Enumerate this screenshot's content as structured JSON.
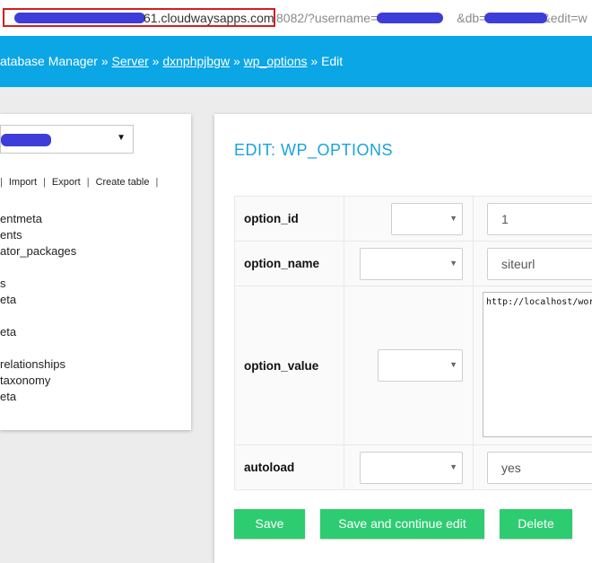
{
  "url": {
    "host": "61.cloudwaysapps.com",
    "rest": "8082/?username=",
    "rest2": "&db=",
    "rest3": "&edit=w"
  },
  "header": {
    "prefix": "atabase Manager » ",
    "crumbs": [
      "Server",
      "dxnphpjbgw",
      "wp_options"
    ],
    "separator": " » ",
    "current": "Edit"
  },
  "sidebar": {
    "actions": [
      "Import",
      "Export",
      "Create table"
    ],
    "tables": [
      "",
      "entmeta",
      "ents",
      "ator_packages",
      "",
      "s",
      "eta",
      "",
      "eta",
      "",
      "relationships",
      "taxonomy",
      "eta"
    ]
  },
  "main": {
    "title": "EDIT: WP_OPTIONS",
    "rows": [
      {
        "label": "option_id",
        "value": "1"
      },
      {
        "label": "option_name",
        "value": "siteurl"
      },
      {
        "label": "option_value",
        "value": "http://localhost/wordpress"
      },
      {
        "label": "autoload",
        "value": "yes"
      }
    ],
    "buttons": {
      "save": "Save",
      "save_continue": "Save and continue edit",
      "delete": "Delete"
    }
  },
  "colors": {
    "header_bg": "#0aa6e6",
    "button_bg": "#2ecc71",
    "title": "#1aa3dc",
    "redact": "#3d3dd8",
    "highlight_box": "#d21f1f"
  },
  "icons": {
    "dropdown": "caret-down-icon"
  }
}
